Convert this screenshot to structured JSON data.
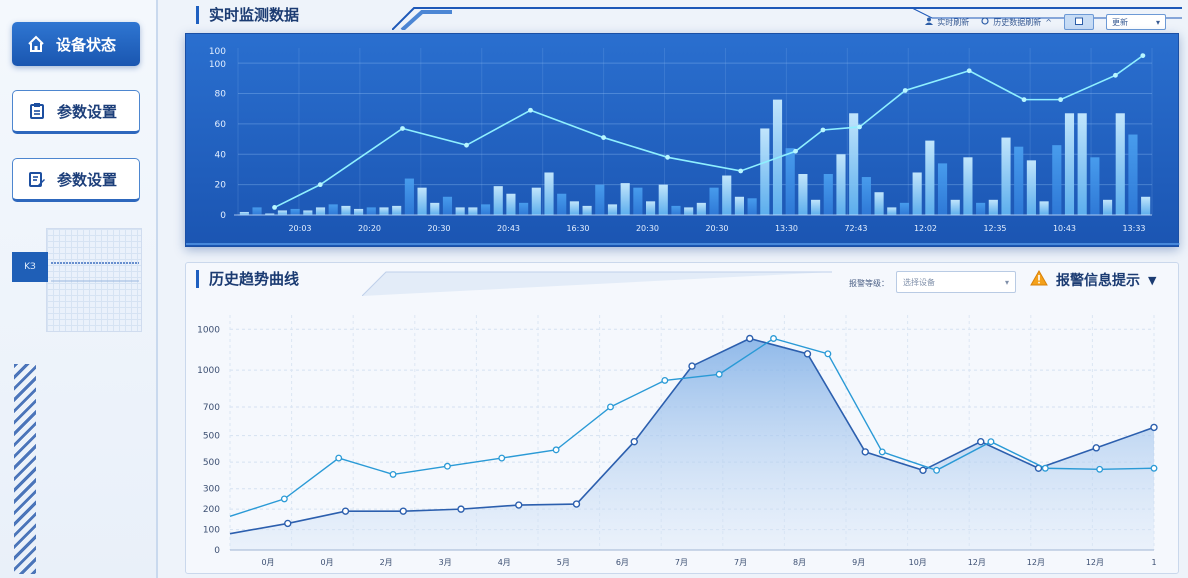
{
  "sidebar": {
    "items": [
      {
        "label": "设备状态",
        "icon": "home-icon",
        "active": true
      },
      {
        "label": "参数设置",
        "icon": "clipboard-icon",
        "active": false
      },
      {
        "label": "参数设置",
        "icon": "edit-doc-icon",
        "active": false
      }
    ],
    "mini_tag": "KЗ"
  },
  "realtime": {
    "title": "实时监测数据",
    "toolbar": {
      "item1": "实时刷新",
      "item2": "历史数据刷新",
      "select_value": "更新"
    },
    "chart_data": {
      "type": "bar",
      "ylim": [
        0,
        110
      ],
      "yticks": [
        0,
        20,
        40,
        60,
        80,
        100,
        100
      ],
      "xticks": [
        "20:03",
        "20:20",
        "20:30",
        "20:43",
        "16:30",
        "20:30",
        "20:30",
        "13:30",
        "72:43",
        "12:02",
        "12:35",
        "10:43",
        "13:33"
      ],
      "bars": [
        2,
        5,
        1,
        3,
        4,
        3,
        5,
        7,
        6,
        4,
        5,
        5,
        6,
        24,
        18,
        8,
        12,
        5,
        5,
        7,
        19,
        14,
        8,
        18,
        28,
        14,
        9,
        6,
        20,
        7,
        21,
        18,
        9,
        20,
        6,
        5,
        8,
        18,
        26,
        12,
        11,
        57,
        76,
        44,
        27,
        10,
        27,
        40,
        67,
        25,
        15,
        5,
        8,
        28,
        49,
        34,
        10,
        38,
        8,
        10,
        51,
        45,
        36,
        9,
        46,
        67,
        67,
        38,
        10,
        67,
        53,
        12
      ],
      "line": [
        {
          "x": 0.04,
          "y": 5
        },
        {
          "x": 0.09,
          "y": 20
        },
        {
          "x": 0.18,
          "y": 57
        },
        {
          "x": 0.25,
          "y": 46
        },
        {
          "x": 0.32,
          "y": 69
        },
        {
          "x": 0.4,
          "y": 51
        },
        {
          "x": 0.47,
          "y": 38
        },
        {
          "x": 0.55,
          "y": 29
        },
        {
          "x": 0.61,
          "y": 42
        },
        {
          "x": 0.64,
          "y": 56
        },
        {
          "x": 0.68,
          "y": 58
        },
        {
          "x": 0.73,
          "y": 82
        },
        {
          "x": 0.8,
          "y": 95
        },
        {
          "x": 0.86,
          "y": 76
        },
        {
          "x": 0.9,
          "y": 76
        },
        {
          "x": 0.96,
          "y": 92
        },
        {
          "x": 0.99,
          "y": 105
        }
      ]
    }
  },
  "history": {
    "title": "历史趋势曲线",
    "filter_label": "报警等级：",
    "filter_placeholder": "选择设备",
    "alert_label": "报警信息提示",
    "chart_data": {
      "type": "area",
      "yticks": [
        "0",
        "100",
        "200",
        "300",
        "500",
        "500",
        "700",
        "1000",
        "1000"
      ],
      "xticks": [
        "0月",
        "0月",
        "2月",
        "3月",
        "4月",
        "5月",
        "6月",
        "7月",
        "7月",
        "8月",
        "9月",
        "10月",
        "12月",
        "12月",
        "12月",
        "1"
      ],
      "series": [
        {
          "name": "area",
          "values": [
            80,
            130,
            190,
            190,
            200,
            220,
            225,
            530,
            900,
            1035,
            960,
            480,
            390,
            530,
            400,
            500,
            600
          ]
        },
        {
          "name": "line",
          "values": [
            165,
            250,
            450,
            370,
            410,
            450,
            490,
            700,
            830,
            860,
            1035,
            960,
            480,
            390,
            530,
            400,
            395,
            400
          ]
        }
      ]
    }
  },
  "colors": {
    "accent": "#1e5fc0",
    "panel_blue": "#2a6fcf",
    "bar_light": "#a9d8fb",
    "line_cyan": "#7fe6f6",
    "area_fill": "#8fb8ea"
  }
}
